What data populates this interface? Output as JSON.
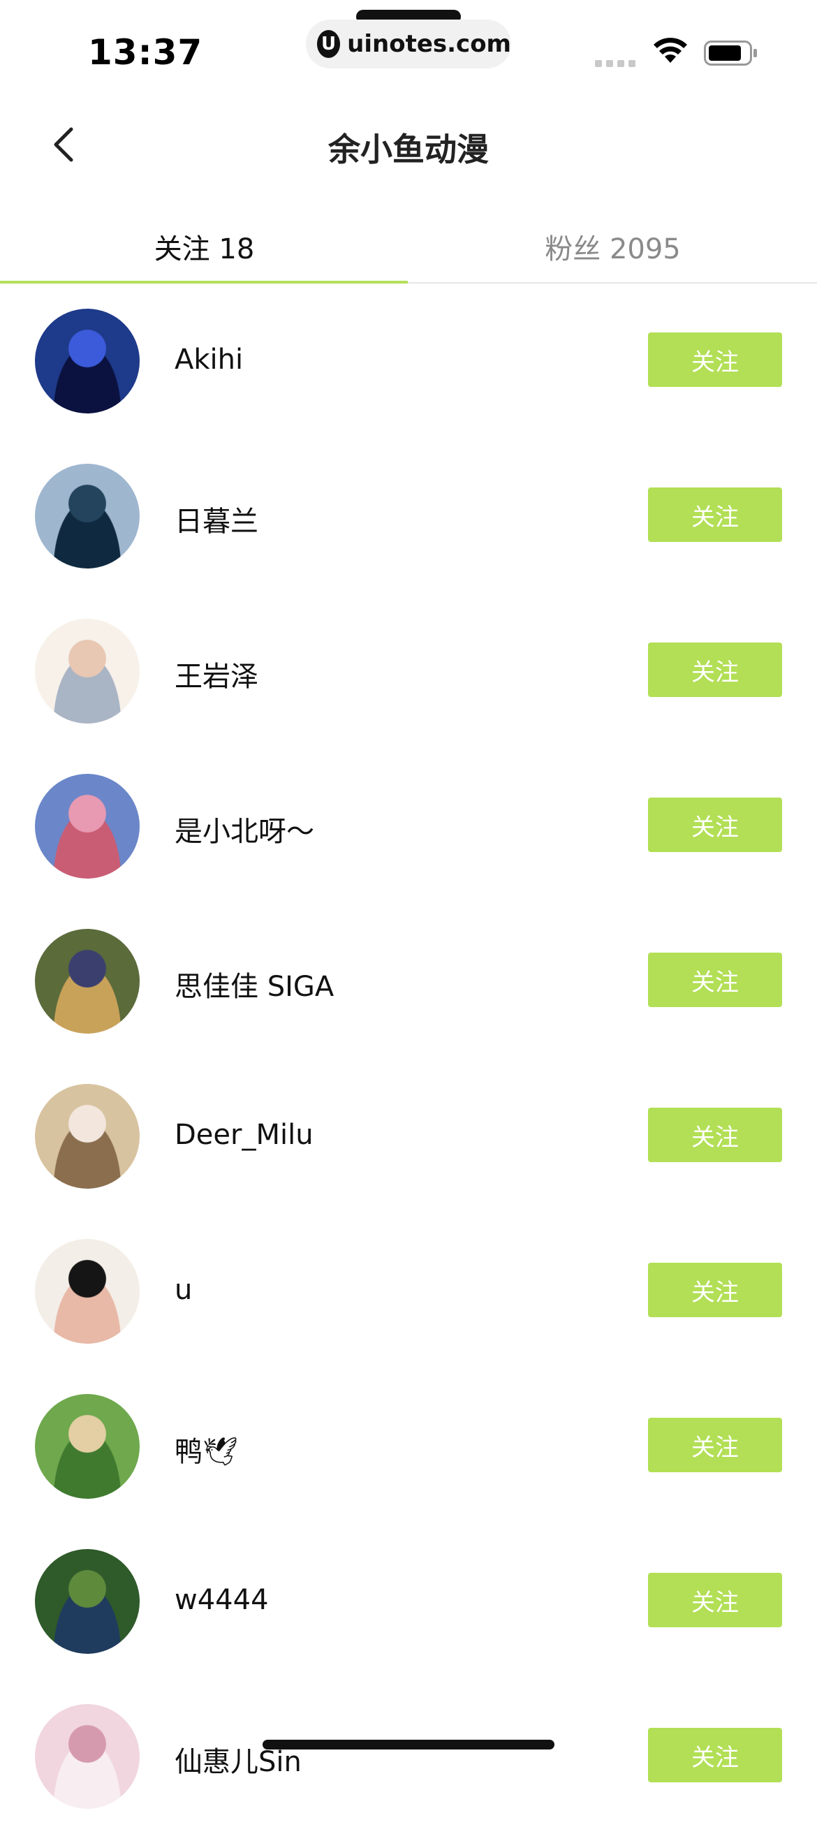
{
  "status": {
    "time": "13:37",
    "url": "uinotes.com",
    "url_logo": "U"
  },
  "header": {
    "title": "余小鱼动漫",
    "back_icon": "chevron-left-icon"
  },
  "tabs": [
    {
      "label": "关注 18",
      "active": true
    },
    {
      "label": "粉丝 2095",
      "active": false
    }
  ],
  "users": [
    {
      "name": "Akihi",
      "button": "关注",
      "avatar_colors": [
        "#1e3a8a",
        "#3b5bdb",
        "#0b1240"
      ]
    },
    {
      "name": "日暮兰",
      "button": "关注",
      "avatar_colors": [
        "#9fb6cf",
        "#24445e",
        "#0f2a40"
      ]
    },
    {
      "name": "王岩泽",
      "button": "关注",
      "avatar_colors": [
        "#f7f1ea",
        "#e8c7b3",
        "#a9b4c4"
      ]
    },
    {
      "name": "是小北呀～",
      "button": "关注",
      "avatar_colors": [
        "#6b86c9",
        "#e79ab2",
        "#c95d74"
      ]
    },
    {
      "name": "思佳佳 SIGA",
      "button": "关注",
      "avatar_colors": [
        "#5b6b3a",
        "#3a3f6e",
        "#c9a25a"
      ]
    },
    {
      "name": "Deer_Milu",
      "button": "关注",
      "avatar_colors": [
        "#d8c3a0",
        "#f2e6dd",
        "#8a6e4e"
      ]
    },
    {
      "name": "u",
      "button": "关注",
      "avatar_colors": [
        "#f4eee8",
        "#151515",
        "#e8b9a7"
      ]
    },
    {
      "name": "鸭🕊",
      "button": "关注",
      "avatar_colors": [
        "#6fa84d",
        "#e3cfa3",
        "#3f7a2f"
      ]
    },
    {
      "name": "w4444",
      "button": "关注",
      "avatar_colors": [
        "#2f5a2a",
        "#5e8a3c",
        "#1f3b5e"
      ]
    },
    {
      "name": "仙惠儿Sin",
      "button": "关注",
      "avatar_colors": [
        "#f1d6df",
        "#d59aae",
        "#f8eef2"
      ]
    }
  ]
}
